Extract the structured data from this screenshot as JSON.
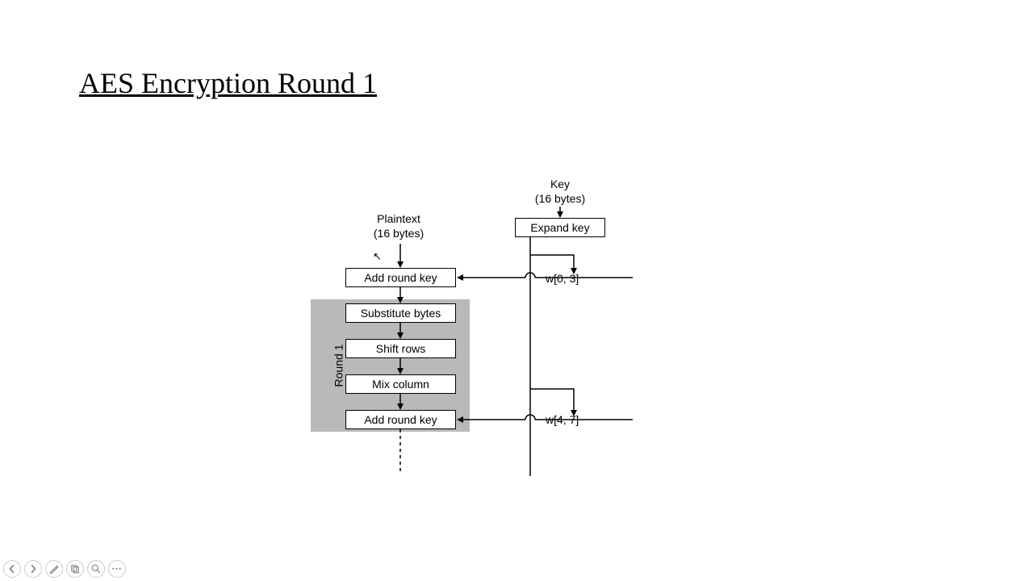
{
  "title": "AES Encryption Round 1",
  "labels": {
    "plaintext": "Plaintext\n(16 bytes)",
    "key": "Key\n(16 bytes)",
    "round": "Round 1",
    "w03": "w[0, 3]",
    "w47": "w[4, 7]"
  },
  "nodes": {
    "add_round_key_0": "Add round key",
    "expand_key": "Expand key",
    "substitute_bytes": "Substitute bytes",
    "shift_rows": "Shift rows",
    "mix_column": "Mix column",
    "add_round_key_1": "Add round key"
  },
  "toolbar": {
    "prev": "Previous",
    "next": "Next",
    "pen": "Pen",
    "copy": "Copy",
    "zoom": "Zoom",
    "more": "More"
  }
}
